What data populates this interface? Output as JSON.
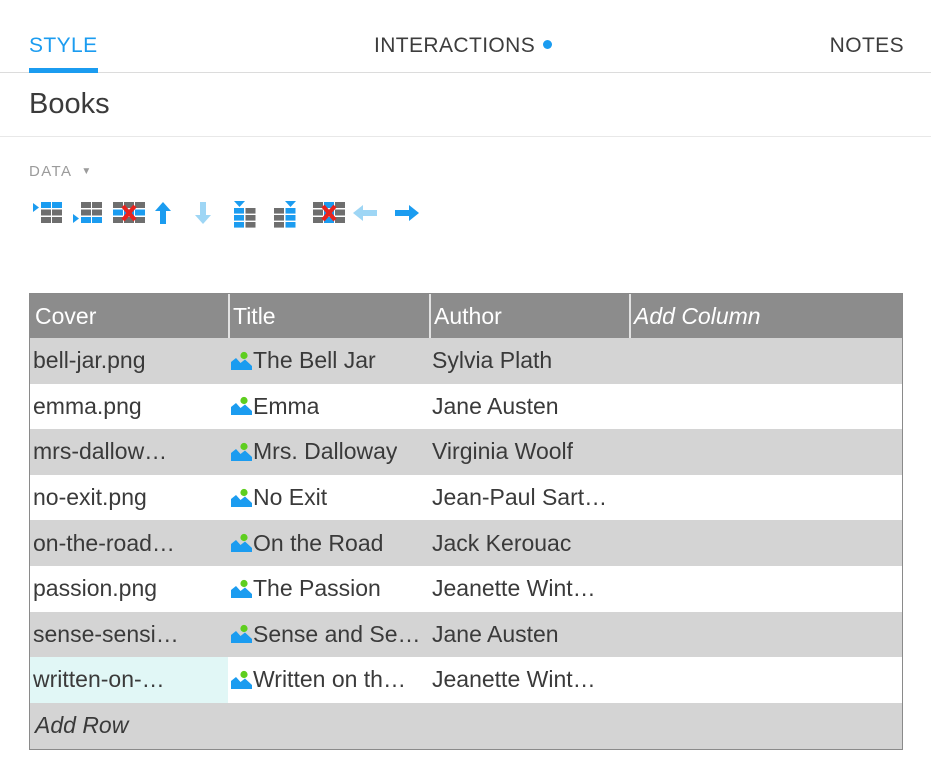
{
  "tabs": [
    {
      "id": "style",
      "label": "STYLE",
      "active": true
    },
    {
      "id": "interactions",
      "label": "INTERACTIONS",
      "has_dot": true
    },
    {
      "id": "notes",
      "label": "NOTES"
    }
  ],
  "header": {
    "page_title": "Books"
  },
  "section": {
    "label": "DATA",
    "caret": "▼"
  },
  "toolbar": {
    "buttons": [
      {
        "name": "insert-row-above",
        "title": "Insert Row Above"
      },
      {
        "name": "insert-row-below",
        "title": "Insert Row Below"
      },
      {
        "name": "delete-row",
        "title": "Delete Row"
      },
      {
        "name": "move-row-up",
        "title": "Move Row Up"
      },
      {
        "name": "move-row-down",
        "title": "Move Row Down"
      },
      {
        "name": "insert-column-left",
        "title": "Insert Column Left"
      },
      {
        "name": "insert-column-right",
        "title": "Insert Column Right"
      },
      {
        "name": "delete-column",
        "title": "Delete Column"
      },
      {
        "name": "move-column-left",
        "title": "Move Column Left"
      },
      {
        "name": "move-column-right",
        "title": "Move Column Right"
      }
    ]
  },
  "table": {
    "columns": [
      "Cover",
      "Title",
      "Author",
      "Add Column"
    ],
    "add_row_label": "Add Row",
    "rows": [
      {
        "cover": "bell-jar.png",
        "title": "The Bell Jar",
        "author": "Sylvia Plath",
        "add": ""
      },
      {
        "cover": "emma.png",
        "title": "Emma",
        "author": "Jane Austen",
        "add": ""
      },
      {
        "cover": "mrs-dallow…",
        "title": "Mrs. Dalloway",
        "author": "Virginia Woolf",
        "add": ""
      },
      {
        "cover": "no-exit.png",
        "title": "No Exit",
        "author": "Jean-Paul Sart…",
        "add": ""
      },
      {
        "cover": "on-the-road…",
        "title": "On the Road",
        "author": "Jack Kerouac",
        "add": ""
      },
      {
        "cover": "passion.png",
        "title": "The Passion",
        "author": "Jeanette Wint…",
        "add": ""
      },
      {
        "cover": "sense-sensi…",
        "title": "Sense and Se…",
        "author": "Jane Austen",
        "add": ""
      },
      {
        "cover": "written-on-…",
        "title": "Written on th…",
        "author": "Jeanette Wint…",
        "add": "",
        "cover_selected": true
      }
    ]
  },
  "colors": {
    "accent": "#1b9cf0",
    "header_bg": "#8c8c8c",
    "row_odd": "#d4d4d4",
    "row_even": "#ffffff",
    "selected_cell": "#e1f7f6",
    "icon_green": "#5ece1f",
    "icon_blue": "#1b9cf0",
    "icon_gray": "#6e6e6e",
    "icon_red": "#e8231e"
  }
}
